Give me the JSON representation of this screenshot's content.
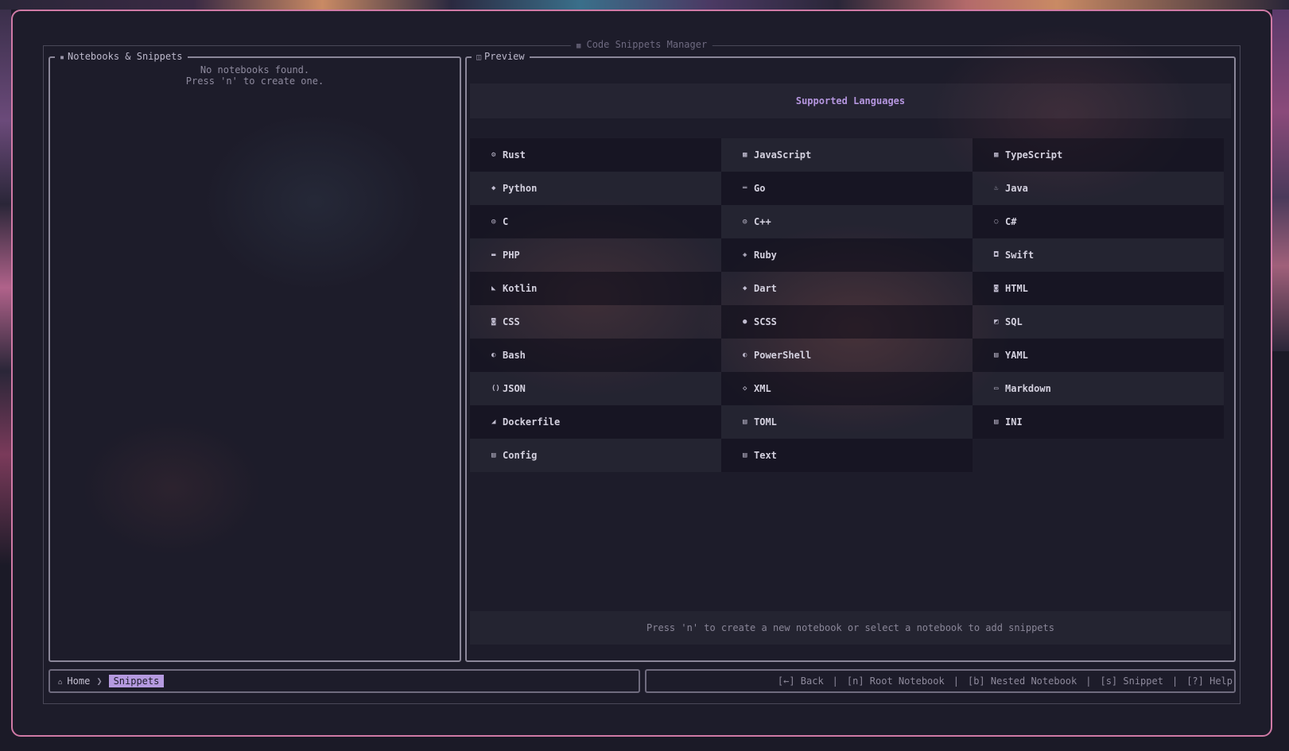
{
  "app": {
    "title": "Code Snippets Manager",
    "title_icon": "grid-icon"
  },
  "left_panel": {
    "title": "Notebooks & Snippets",
    "title_icon": "notebook-icon",
    "empty_line1": "No notebooks found.",
    "empty_line2": "Press 'n' to create one."
  },
  "preview": {
    "title": "Preview",
    "title_icon": "preview-icon",
    "header": "Supported Languages",
    "languages": [
      {
        "name": "Rust",
        "icon": "⚙"
      },
      {
        "name": "JavaScript",
        "icon": "▩"
      },
      {
        "name": "TypeScript",
        "icon": "▩"
      },
      {
        "name": "Python",
        "icon": "◆"
      },
      {
        "name": "Go",
        "icon": "═"
      },
      {
        "name": "Java",
        "icon": "♨"
      },
      {
        "name": "C",
        "icon": "◎"
      },
      {
        "name": "C++",
        "icon": "◎"
      },
      {
        "name": "C#",
        "icon": "◌"
      },
      {
        "name": "PHP",
        "icon": "▬"
      },
      {
        "name": "Ruby",
        "icon": "◈"
      },
      {
        "name": "Swift",
        "icon": "◘"
      },
      {
        "name": "Kotlin",
        "icon": "◣"
      },
      {
        "name": "Dart",
        "icon": "◆"
      },
      {
        "name": "HTML",
        "icon": "◙"
      },
      {
        "name": "CSS",
        "icon": "◙"
      },
      {
        "name": "SCSS",
        "icon": "●"
      },
      {
        "name": "SQL",
        "icon": "◩"
      },
      {
        "name": "Bash",
        "icon": "◐"
      },
      {
        "name": "PowerShell",
        "icon": "◐"
      },
      {
        "name": "YAML",
        "icon": "▤"
      },
      {
        "name": "JSON",
        "icon": "()"
      },
      {
        "name": "XML",
        "icon": "◇"
      },
      {
        "name": "Markdown",
        "icon": "▭"
      },
      {
        "name": "Dockerfile",
        "icon": "◢"
      },
      {
        "name": "TOML",
        "icon": "▤"
      },
      {
        "name": "INI",
        "icon": "▤"
      },
      {
        "name": "Config",
        "icon": "▤"
      },
      {
        "name": "Text",
        "icon": "▤"
      }
    ],
    "hint": "Press 'n' to create a new notebook or select a notebook to add snippets"
  },
  "breadcrumb": {
    "home_icon": "home-icon",
    "home": "Home",
    "separator": "❯",
    "current": "Snippets"
  },
  "keys": [
    {
      "label": "[←] Back"
    },
    {
      "label": "[n] Root Notebook"
    },
    {
      "label": "[b] Nested Notebook"
    },
    {
      "label": "[s] Snippet"
    },
    {
      "label": "[?] Help"
    }
  ],
  "colors": {
    "window_border": "#d07aa6",
    "panel_border": "#8b8799",
    "accent": "#b596df",
    "background": "#1d1c2a"
  }
}
